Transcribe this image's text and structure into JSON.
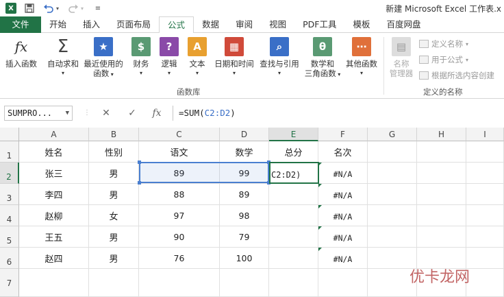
{
  "titlebar": {
    "app_logo": "X",
    "qat": [
      "save-icon",
      "undo-icon",
      "redo-icon",
      "customize-icon"
    ],
    "title": "新建 Microsoft Excel 工作表.x"
  },
  "tabs": [
    "文件",
    "开始",
    "插入",
    "页面布局",
    "公式",
    "数据",
    "审阅",
    "视图",
    "PDF工具",
    "模板",
    "百度网盘"
  ],
  "active_tab": "公式",
  "ribbon": {
    "insert_function": "插入函数",
    "autosum": "自动求和",
    "recent_line1": "最近使用的",
    "recent_line2": "函数",
    "financial": "财务",
    "logical": "逻辑",
    "text": "文本",
    "datetime": "日期和时间",
    "lookup": "查找与引用",
    "math_line1": "数学和",
    "math_line2": "三角函数",
    "other": "其他函数",
    "library_group": "函数库",
    "name_mgr_line1": "名称",
    "name_mgr_line2": "管理器",
    "define_name": "定义名称",
    "use_in_formula": "用于公式",
    "create_from_sel": "根据所选内容创建",
    "defined_names_group": "定义的名称"
  },
  "formula_bar": {
    "name_box": "SUMPRO...",
    "cancel": "✕",
    "enter": "✓",
    "fx": "fx",
    "formula_prefix": "=SUM(",
    "formula_ref": "C2:D2",
    "formula_suffix": ")"
  },
  "grid": {
    "columns": [
      "A",
      "B",
      "C",
      "D",
      "E",
      "F",
      "G",
      "H",
      "I"
    ],
    "rows": [
      "1",
      "2",
      "3",
      "4",
      "5",
      "6",
      "7"
    ],
    "header_row": [
      "姓名",
      "性别",
      "语文",
      "数学",
      "总分",
      "名次"
    ],
    "data": [
      [
        "张三",
        "男",
        "89",
        "99",
        "C2:D2)",
        "#N/A"
      ],
      [
        "李四",
        "男",
        "88",
        "89",
        "",
        "#N/A"
      ],
      [
        "赵柳",
        "女",
        "97",
        "98",
        "",
        "#N/A"
      ],
      [
        "王五",
        "男",
        "90",
        "79",
        "",
        "#N/A"
      ],
      [
        "赵四",
        "男",
        "76",
        "100",
        "",
        "#N/A"
      ]
    ]
  },
  "watermark": "优卡龙网",
  "colors": {
    "excel_green": "#217346",
    "ref_blue": "#3a6fc7"
  }
}
